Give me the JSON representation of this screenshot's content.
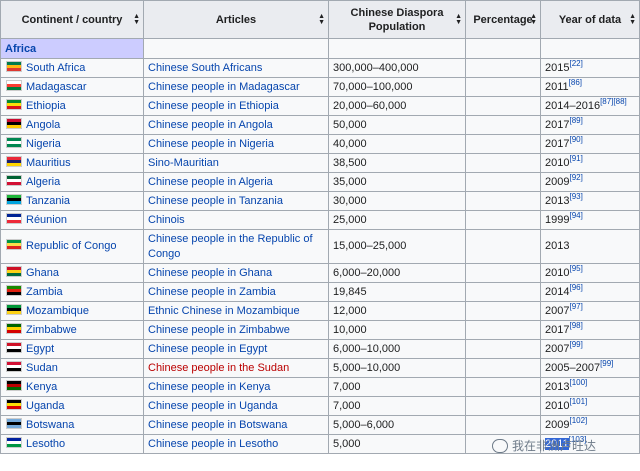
{
  "header": {
    "col1": "Continent / country",
    "col2": "Articles",
    "col3": "Chinese Diaspora Population",
    "col4": "Percentage",
    "col5": "Year of data"
  },
  "region": "Africa",
  "rows": [
    {
      "country": "South Africa",
      "article": "Chinese South Africans",
      "pop": "300,000–400,000",
      "pct": "",
      "year": "2015",
      "ref": "[22]"
    },
    {
      "country": "Madagascar",
      "article": "Chinese people in Madagascar",
      "pop": "70,000–100,000",
      "pct": "",
      "year": "2011",
      "ref": "[86]"
    },
    {
      "country": "Ethiopia",
      "article": "Chinese people in Ethiopia",
      "pop": "20,000–60,000",
      "pct": "",
      "year": "2014–2016",
      "ref": "[87][88]"
    },
    {
      "country": "Angola",
      "article": "Chinese people in Angola",
      "pop": "50,000",
      "pct": "",
      "year": "2017",
      "ref": "[89]"
    },
    {
      "country": "Nigeria",
      "article": "Chinese people in Nigeria",
      "pop": "40,000",
      "pct": "",
      "year": "2017",
      "ref": "[90]"
    },
    {
      "country": "Mauritius",
      "article": "Sino-Mauritian",
      "pop": "38,500",
      "pct": "",
      "year": "2010",
      "ref": "[91]"
    },
    {
      "country": "Algeria",
      "article": "Chinese people in Algeria",
      "pop": "35,000",
      "pct": "",
      "year": "2009",
      "ref": "[92]"
    },
    {
      "country": "Tanzania",
      "article": "Chinese people in Tanzania",
      "pop": "30,000",
      "pct": "",
      "year": "2013",
      "ref": "[93]"
    },
    {
      "country": "Réunion",
      "article": "Chinois",
      "pop": "25,000",
      "pct": "",
      "year": "1999",
      "ref": "[94]"
    },
    {
      "country": "Republic of Congo",
      "article": "Chinese people in the Republic of Congo",
      "pop": "15,000–25,000",
      "pct": "",
      "year": "2013",
      "ref": ""
    },
    {
      "country": "Ghana",
      "article": "Chinese people in Ghana",
      "pop": "6,000–20,000",
      "pct": "",
      "year": "2010",
      "ref": "[95]"
    },
    {
      "country": "Zambia",
      "article": "Chinese people in Zambia",
      "pop": "19,845",
      "pct": "",
      "year": "2014",
      "ref": "[96]"
    },
    {
      "country": "Mozambique",
      "article": "Ethnic Chinese in Mozambique",
      "pop": "12,000",
      "pct": "",
      "year": "2007",
      "ref": "[97]"
    },
    {
      "country": "Zimbabwe",
      "article": "Chinese people in Zimbabwe",
      "pop": "10,000",
      "pct": "",
      "year": "2017",
      "ref": "[98]"
    },
    {
      "country": "Egypt",
      "article": "Chinese people in Egypt",
      "pop": "6,000–10,000",
      "pct": "",
      "year": "2007",
      "ref": "[99]"
    },
    {
      "country": "Sudan",
      "article": "Chinese people in the Sudan",
      "pop": "5,000–10,000",
      "pct": "",
      "year": "2005–2007",
      "ref": "[99]"
    },
    {
      "country": "Kenya",
      "article": "Chinese people in Kenya",
      "pop": "7,000",
      "pct": "",
      "year": "2013",
      "ref": "[100]"
    },
    {
      "country": "Uganda",
      "article": "Chinese people in Uganda",
      "pop": "7,000",
      "pct": "",
      "year": "2010",
      "ref": "[101]"
    },
    {
      "country": "Botswana",
      "article": "Chinese people in Botswana",
      "pop": "5,000–6,000",
      "pct": "",
      "year": "2009",
      "ref": "[102]"
    },
    {
      "country": "Lesotho",
      "article": "Chinese people in Lesotho",
      "pop": "5,000",
      "pct": "",
      "year": "2011",
      "ref": "[103]"
    }
  ],
  "flag_colors": {
    "South Africa": [
      "#007a4d",
      "#ffb612",
      "#de3831"
    ],
    "Madagascar": [
      "#ffffff",
      "#fc3d32",
      "#007e3a"
    ],
    "Ethiopia": [
      "#078930",
      "#fcdd09",
      "#da121a"
    ],
    "Angola": [
      "#cc092f",
      "#000000",
      "#ffcb00"
    ],
    "Nigeria": [
      "#008751",
      "#ffffff",
      "#008751"
    ],
    "Mauritius": [
      "#ea2839",
      "#1a206d",
      "#ffd500"
    ],
    "Algeria": [
      "#006233",
      "#ffffff",
      "#d21034"
    ],
    "Tanzania": [
      "#1eb53a",
      "#000000",
      "#00a3dd"
    ],
    "Réunion": [
      "#002395",
      "#ffffff",
      "#ed2939"
    ],
    "Republic of Congo": [
      "#009543",
      "#fbde4a",
      "#dc241f"
    ],
    "Ghana": [
      "#ce1126",
      "#fcd116",
      "#006b3f"
    ],
    "Zambia": [
      "#198a00",
      "#de2010",
      "#000000"
    ],
    "Mozambique": [
      "#009739",
      "#000000",
      "#fcd116"
    ],
    "Zimbabwe": [
      "#006400",
      "#ffd200",
      "#d40000"
    ],
    "Egypt": [
      "#ce1126",
      "#ffffff",
      "#000000"
    ],
    "Sudan": [
      "#d21034",
      "#ffffff",
      "#000000"
    ],
    "Kenya": [
      "#000000",
      "#bb0000",
      "#006600"
    ],
    "Uganda": [
      "#000000",
      "#fcdc04",
      "#d90000"
    ],
    "Botswana": [
      "#75aadb",
      "#000000",
      "#75aadb"
    ],
    "Lesotho": [
      "#00209f",
      "#ffffff",
      "#009543"
    ]
  },
  "red_links": [
    "Chinese people in the Sudan"
  ],
  "watermark": "我在非洲卢旺达",
  "highlighted_year": "2011"
}
